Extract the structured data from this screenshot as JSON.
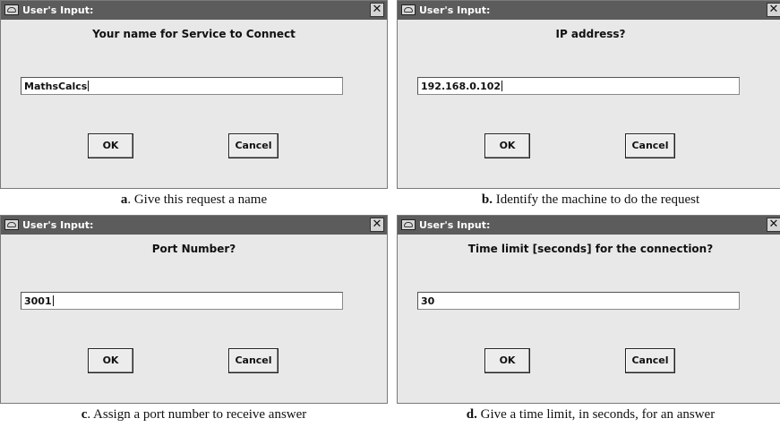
{
  "dialogs": [
    {
      "title": "User's Input:",
      "prompt": "Your name for Service to Connect",
      "value": "MathsCalcs",
      "ok_label": "OK",
      "cancel_label": "Cancel",
      "close_glyph": "✕",
      "caption_letter": "a",
      "caption_text": ". Give this request a name"
    },
    {
      "title": "User's Input:",
      "prompt": "IP address?",
      "value": "192.168.0.102",
      "ok_label": "OK",
      "cancel_label": "Cancel",
      "close_glyph": "✕",
      "caption_letter": "b.",
      "caption_text": " Identify the machine to do the request"
    },
    {
      "title": "User's Input:",
      "prompt": "Port Number?",
      "value": "3001",
      "ok_label": "OK",
      "cancel_label": "Cancel",
      "close_glyph": "✕",
      "caption_letter": "c",
      "caption_text": ". Assign a port number to receive answer"
    },
    {
      "title": "User's Input:",
      "prompt": "Time limit [seconds] for the connection?",
      "value": "30",
      "ok_label": "OK",
      "cancel_label": "Cancel",
      "close_glyph": "✕",
      "caption_letter": "d.",
      "caption_text": " Give a time limit, in seconds, for an answer"
    }
  ],
  "icons": {
    "app": "window-app-icon",
    "close": "close-icon"
  },
  "colors": {
    "titlebar": "#5c5c5c",
    "dialog_bg": "#e8e8e8"
  }
}
